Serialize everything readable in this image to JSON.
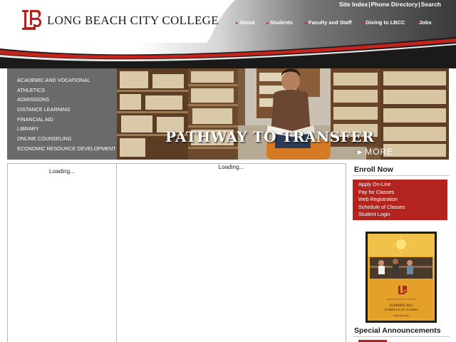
{
  "toplinks": {
    "site_index": "Site Index",
    "phone_directory": "Phone Directory",
    "search": "Search",
    "separator": "|"
  },
  "logo": {
    "name": "Long Beach City College",
    "display": "LONG BEACH CITY COLLEGE"
  },
  "mainnav": [
    {
      "label": "About"
    },
    {
      "label": "Students"
    },
    {
      "label": "Faculty and Staff"
    },
    {
      "label": "Giving to LBCC"
    },
    {
      "label": "Jobs"
    }
  ],
  "leftnav": [
    {
      "label": "ACADEMIC AND VOCATIONAL"
    },
    {
      "label": "ATHLETICS"
    },
    {
      "label": "ADMISSIONS"
    },
    {
      "label": "DISTANCE LEARNING"
    },
    {
      "label": "FINANCIAL AID"
    },
    {
      "label": "LIBRARY"
    },
    {
      "label": "ONLINE COUNSELING"
    },
    {
      "label": "ECONOMIC RESOURCE DEVELOPMENT"
    }
  ],
  "banner": {
    "caption": "PATHWAY TO TRANSFER",
    "more": "MORE"
  },
  "left_column": {
    "status": "Loading..."
  },
  "middle_column": {
    "status": "Loading..."
  },
  "enroll": {
    "title": "Enroll Now",
    "links": [
      {
        "label": "Apply On-Line"
      },
      {
        "label": "Pay for Classes"
      },
      {
        "label": "Web Registration"
      },
      {
        "label": "Schedule of Classes"
      },
      {
        "label": "Student Login"
      }
    ]
  },
  "poster": {
    "line1": "SUMMER 2012",
    "line2": "SCHEDULE OF CLASSES",
    "college": "LONG BEACH CITY COLLEGE",
    "url": "WWW.LBCC.EDU"
  },
  "announcements": {
    "title": "Special Announcements"
  },
  "colors": {
    "brand_red": "#b3241e",
    "dark_gray": "#6a6a6a",
    "text": "#1a1a1a"
  }
}
